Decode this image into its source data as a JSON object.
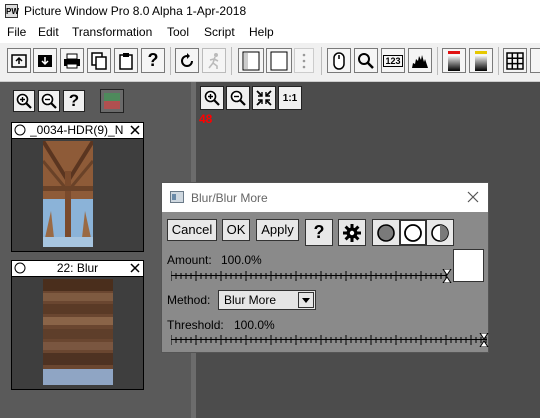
{
  "window": {
    "title": "Picture Window Pro 8.0 Alpha 1-Apr-2018"
  },
  "menu": [
    "File",
    "Edit",
    "Transformation",
    "Tool",
    "Script",
    "Help"
  ],
  "toolbar": {
    "counter_label": "123"
  },
  "viewer": {
    "zoom_label": "1:1",
    "zoom_percent": "48"
  },
  "thumbnails": [
    {
      "name": "_0034-HDR(9)_N"
    },
    {
      "name": "22: Blur"
    }
  ],
  "dialog": {
    "title": "Blur/Blur More",
    "cancel_label": "Cancel",
    "ok_label": "OK",
    "apply_label": "Apply",
    "help_label": "?",
    "amount_label": "Amount:",
    "amount_value": "100.0%",
    "method_label": "Method:",
    "method_value": "Blur More",
    "threshold_label": "Threshold:",
    "threshold_value": "100.0%",
    "amount_fraction": 1.0,
    "threshold_fraction": 1.0
  },
  "colors": {
    "percent_text": "#ff0000",
    "panel": "#5a5a5a",
    "workspace": "#4c4c4c",
    "dialog": "#8a8a8a"
  }
}
